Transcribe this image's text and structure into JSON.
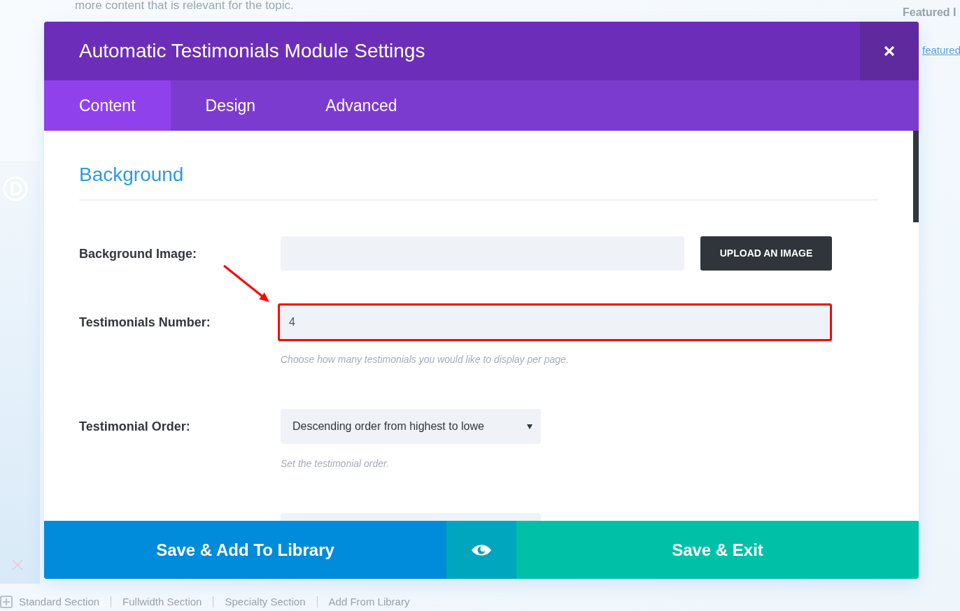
{
  "page": {
    "intro_text": "more content that is relevant for the topic.",
    "sidebar_title": "Featured I",
    "sidebar_link": "featured",
    "section_bar": [
      "Standard Section",
      "Fullwidth Section",
      "Specialty Section",
      "Add From Library"
    ]
  },
  "modal": {
    "title": "Automatic Testimonials Module Settings",
    "tabs": [
      {
        "label": "Content",
        "selected": true
      },
      {
        "label": "Design",
        "selected": false
      },
      {
        "label": "Advanced",
        "selected": false
      }
    ],
    "section_heading": "Background",
    "fields": [
      {
        "kind": "upload",
        "label": "Background Image:",
        "button": "UPLOAD AN IMAGE",
        "highlighted": false
      },
      {
        "kind": "text",
        "label": "Testimonials Number:",
        "value": "4",
        "hint": "Choose how many testimonials you would like to display per page.",
        "highlighted": true
      },
      {
        "kind": "select",
        "label": "Testimonial Order:",
        "value": "Descending order from highest to lowe",
        "hint": "Set the testimonial order.",
        "highlighted": false
      },
      {
        "kind": "select",
        "highlighted": false
      }
    ],
    "footer": {
      "library_button": "Save & Add To Library",
      "exit_button": "Save & Exit"
    }
  }
}
